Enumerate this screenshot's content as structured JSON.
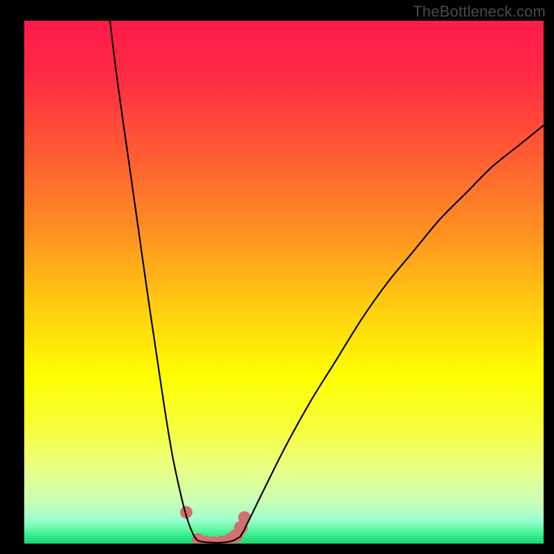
{
  "attribution": "TheBottleneck.com",
  "colors": {
    "background": "#000000",
    "gradient_stops": [
      {
        "offset": 0.0,
        "color": "#ff1b4b"
      },
      {
        "offset": 0.1,
        "color": "#ff2a44"
      },
      {
        "offset": 0.25,
        "color": "#ff5a33"
      },
      {
        "offset": 0.4,
        "color": "#ff8f22"
      },
      {
        "offset": 0.55,
        "color": "#ffce0f"
      },
      {
        "offset": 0.68,
        "color": "#ffff00"
      },
      {
        "offset": 0.78,
        "color": "#f6ff3c"
      },
      {
        "offset": 0.86,
        "color": "#e8ff88"
      },
      {
        "offset": 0.92,
        "color": "#c8ffb6"
      },
      {
        "offset": 0.955,
        "color": "#9dffcf"
      },
      {
        "offset": 0.975,
        "color": "#58f7a0"
      },
      {
        "offset": 0.99,
        "color": "#24e57d"
      },
      {
        "offset": 1.0,
        "color": "#18d873"
      }
    ],
    "curve": "#000000",
    "marker_fill": "#d27070",
    "attribution_text": "#4a4a4a"
  },
  "chart_data": {
    "type": "line",
    "title": "",
    "xlabel": "",
    "ylabel": "",
    "xlim": [
      0,
      100
    ],
    "ylim": [
      0,
      100
    ],
    "series": [
      {
        "name": "left-branch",
        "x": [
          16.5,
          18,
          20,
          22,
          24,
          25.5,
          27,
          28.5,
          30,
          31,
          32,
          33
        ],
        "y": [
          100,
          88,
          74,
          60,
          46,
          36,
          26,
          17,
          10,
          6,
          3,
          1
        ]
      },
      {
        "name": "valley",
        "x": [
          33,
          34,
          36,
          38,
          40,
          41,
          42
        ],
        "y": [
          1,
          0.4,
          0.2,
          0.2,
          0.5,
          1.0,
          2.0
        ]
      },
      {
        "name": "right-branch",
        "x": [
          42,
          45,
          50,
          55,
          60,
          65,
          70,
          75,
          80,
          85,
          90,
          95,
          100
        ],
        "y": [
          2,
          8,
          18,
          27,
          35,
          43,
          50,
          56,
          62,
          67,
          72,
          76,
          80
        ]
      }
    ],
    "markers": {
      "name": "highlight-points",
      "x": [
        31.2,
        33.5,
        35.0,
        36.5,
        38.0,
        39.5,
        40.8,
        41.7,
        42.4
      ],
      "y": [
        6.0,
        0.8,
        0.3,
        0.2,
        0.3,
        0.8,
        1.5,
        3.0,
        5.0
      ],
      "radius": [
        9,
        9,
        9,
        9,
        9,
        9,
        10,
        10,
        9
      ]
    }
  }
}
